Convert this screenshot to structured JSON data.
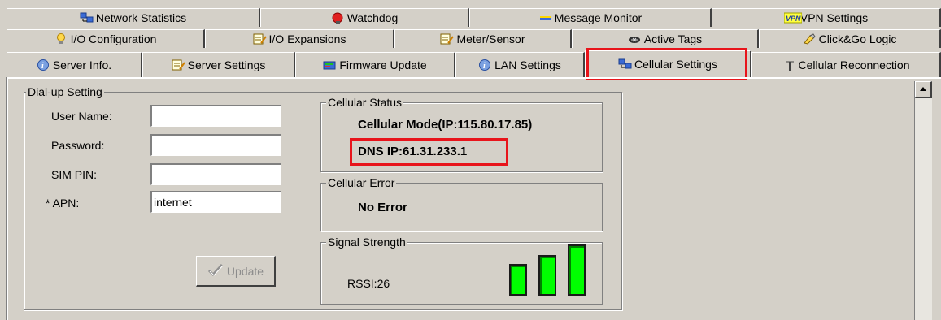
{
  "tabs": {
    "row1": [
      {
        "label": "Network Statistics",
        "icon": "network-icon"
      },
      {
        "label": "Watchdog",
        "icon": "watchdog-icon"
      },
      {
        "label": "Message Monitor",
        "icon": "message-icon"
      },
      {
        "label": "VPN Settings",
        "icon": "vpn-icon"
      }
    ],
    "row2": [
      {
        "label": "I/O Configuration",
        "icon": "lightbulb-icon"
      },
      {
        "label": "I/O Expansions",
        "icon": "expansion-icon"
      },
      {
        "label": "Meter/Sensor",
        "icon": "meter-icon"
      },
      {
        "label": "Active Tags",
        "icon": "tags-icon"
      },
      {
        "label": "Click&Go Logic",
        "icon": "logic-icon"
      }
    ],
    "row3": [
      {
        "label": "Server Info.",
        "icon": "info-icon"
      },
      {
        "label": "Server Settings",
        "icon": "settings-icon"
      },
      {
        "label": "Firmware Update",
        "icon": "firmware-icon"
      },
      {
        "label": "LAN Settings",
        "icon": "info-icon"
      },
      {
        "label": "Cellular Settings",
        "icon": "network-icon"
      },
      {
        "label": "Cellular Reconnection",
        "icon": "antenna-icon"
      }
    ],
    "active": "Cellular Settings"
  },
  "dialup": {
    "legend": "Dial-up Setting",
    "username_label": "User Name:",
    "username_value": "",
    "password_label": "Password:",
    "password_value": "",
    "simpin_label": "SIM PIN:",
    "simpin_value": "",
    "apn_label": "* APN:",
    "apn_value": "internet",
    "update_label": "Update"
  },
  "cellular_status": {
    "legend": "Cellular Status",
    "mode": "Cellular Mode(IP:115.80.17.85)",
    "dns": "DNS IP:61.31.233.1"
  },
  "cellular_error": {
    "legend": "Cellular Error",
    "value": "No Error"
  },
  "signal": {
    "legend": "Signal Strength",
    "rssi": "RSSI:26",
    "bars": 3
  },
  "colors": {
    "highlight": "#e8141b",
    "bar_green": "#00ff00",
    "window_bg": "#d4d0c8"
  }
}
